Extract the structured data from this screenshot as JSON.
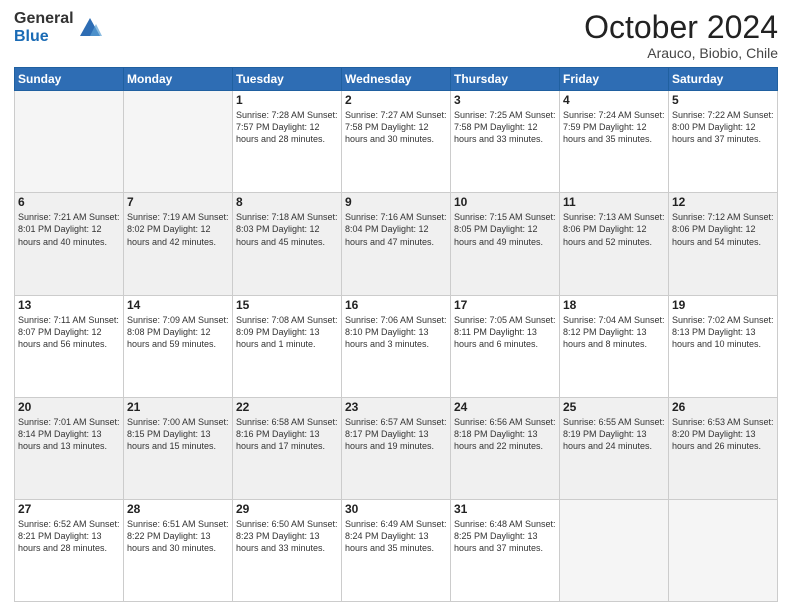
{
  "logo": {
    "general": "General",
    "blue": "Blue"
  },
  "header": {
    "month": "October 2024",
    "location": "Arauco, Biobio, Chile"
  },
  "days_of_week": [
    "Sunday",
    "Monday",
    "Tuesday",
    "Wednesday",
    "Thursday",
    "Friday",
    "Saturday"
  ],
  "weeks": [
    [
      {
        "day": "",
        "info": ""
      },
      {
        "day": "",
        "info": ""
      },
      {
        "day": "1",
        "info": "Sunrise: 7:28 AM\nSunset: 7:57 PM\nDaylight: 12 hours and 28 minutes."
      },
      {
        "day": "2",
        "info": "Sunrise: 7:27 AM\nSunset: 7:58 PM\nDaylight: 12 hours and 30 minutes."
      },
      {
        "day": "3",
        "info": "Sunrise: 7:25 AM\nSunset: 7:58 PM\nDaylight: 12 hours and 33 minutes."
      },
      {
        "day": "4",
        "info": "Sunrise: 7:24 AM\nSunset: 7:59 PM\nDaylight: 12 hours and 35 minutes."
      },
      {
        "day": "5",
        "info": "Sunrise: 7:22 AM\nSunset: 8:00 PM\nDaylight: 12 hours and 37 minutes."
      }
    ],
    [
      {
        "day": "6",
        "info": "Sunrise: 7:21 AM\nSunset: 8:01 PM\nDaylight: 12 hours and 40 minutes."
      },
      {
        "day": "7",
        "info": "Sunrise: 7:19 AM\nSunset: 8:02 PM\nDaylight: 12 hours and 42 minutes."
      },
      {
        "day": "8",
        "info": "Sunrise: 7:18 AM\nSunset: 8:03 PM\nDaylight: 12 hours and 45 minutes."
      },
      {
        "day": "9",
        "info": "Sunrise: 7:16 AM\nSunset: 8:04 PM\nDaylight: 12 hours and 47 minutes."
      },
      {
        "day": "10",
        "info": "Sunrise: 7:15 AM\nSunset: 8:05 PM\nDaylight: 12 hours and 49 minutes."
      },
      {
        "day": "11",
        "info": "Sunrise: 7:13 AM\nSunset: 8:06 PM\nDaylight: 12 hours and 52 minutes."
      },
      {
        "day": "12",
        "info": "Sunrise: 7:12 AM\nSunset: 8:06 PM\nDaylight: 12 hours and 54 minutes."
      }
    ],
    [
      {
        "day": "13",
        "info": "Sunrise: 7:11 AM\nSunset: 8:07 PM\nDaylight: 12 hours and 56 minutes."
      },
      {
        "day": "14",
        "info": "Sunrise: 7:09 AM\nSunset: 8:08 PM\nDaylight: 12 hours and 59 minutes."
      },
      {
        "day": "15",
        "info": "Sunrise: 7:08 AM\nSunset: 8:09 PM\nDaylight: 13 hours and 1 minute."
      },
      {
        "day": "16",
        "info": "Sunrise: 7:06 AM\nSunset: 8:10 PM\nDaylight: 13 hours and 3 minutes."
      },
      {
        "day": "17",
        "info": "Sunrise: 7:05 AM\nSunset: 8:11 PM\nDaylight: 13 hours and 6 minutes."
      },
      {
        "day": "18",
        "info": "Sunrise: 7:04 AM\nSunset: 8:12 PM\nDaylight: 13 hours and 8 minutes."
      },
      {
        "day": "19",
        "info": "Sunrise: 7:02 AM\nSunset: 8:13 PM\nDaylight: 13 hours and 10 minutes."
      }
    ],
    [
      {
        "day": "20",
        "info": "Sunrise: 7:01 AM\nSunset: 8:14 PM\nDaylight: 13 hours and 13 minutes."
      },
      {
        "day": "21",
        "info": "Sunrise: 7:00 AM\nSunset: 8:15 PM\nDaylight: 13 hours and 15 minutes."
      },
      {
        "day": "22",
        "info": "Sunrise: 6:58 AM\nSunset: 8:16 PM\nDaylight: 13 hours and 17 minutes."
      },
      {
        "day": "23",
        "info": "Sunrise: 6:57 AM\nSunset: 8:17 PM\nDaylight: 13 hours and 19 minutes."
      },
      {
        "day": "24",
        "info": "Sunrise: 6:56 AM\nSunset: 8:18 PM\nDaylight: 13 hours and 22 minutes."
      },
      {
        "day": "25",
        "info": "Sunrise: 6:55 AM\nSunset: 8:19 PM\nDaylight: 13 hours and 24 minutes."
      },
      {
        "day": "26",
        "info": "Sunrise: 6:53 AM\nSunset: 8:20 PM\nDaylight: 13 hours and 26 minutes."
      }
    ],
    [
      {
        "day": "27",
        "info": "Sunrise: 6:52 AM\nSunset: 8:21 PM\nDaylight: 13 hours and 28 minutes."
      },
      {
        "day": "28",
        "info": "Sunrise: 6:51 AM\nSunset: 8:22 PM\nDaylight: 13 hours and 30 minutes."
      },
      {
        "day": "29",
        "info": "Sunrise: 6:50 AM\nSunset: 8:23 PM\nDaylight: 13 hours and 33 minutes."
      },
      {
        "day": "30",
        "info": "Sunrise: 6:49 AM\nSunset: 8:24 PM\nDaylight: 13 hours and 35 minutes."
      },
      {
        "day": "31",
        "info": "Sunrise: 6:48 AM\nSunset: 8:25 PM\nDaylight: 13 hours and 37 minutes."
      },
      {
        "day": "",
        "info": ""
      },
      {
        "day": "",
        "info": ""
      }
    ]
  ]
}
